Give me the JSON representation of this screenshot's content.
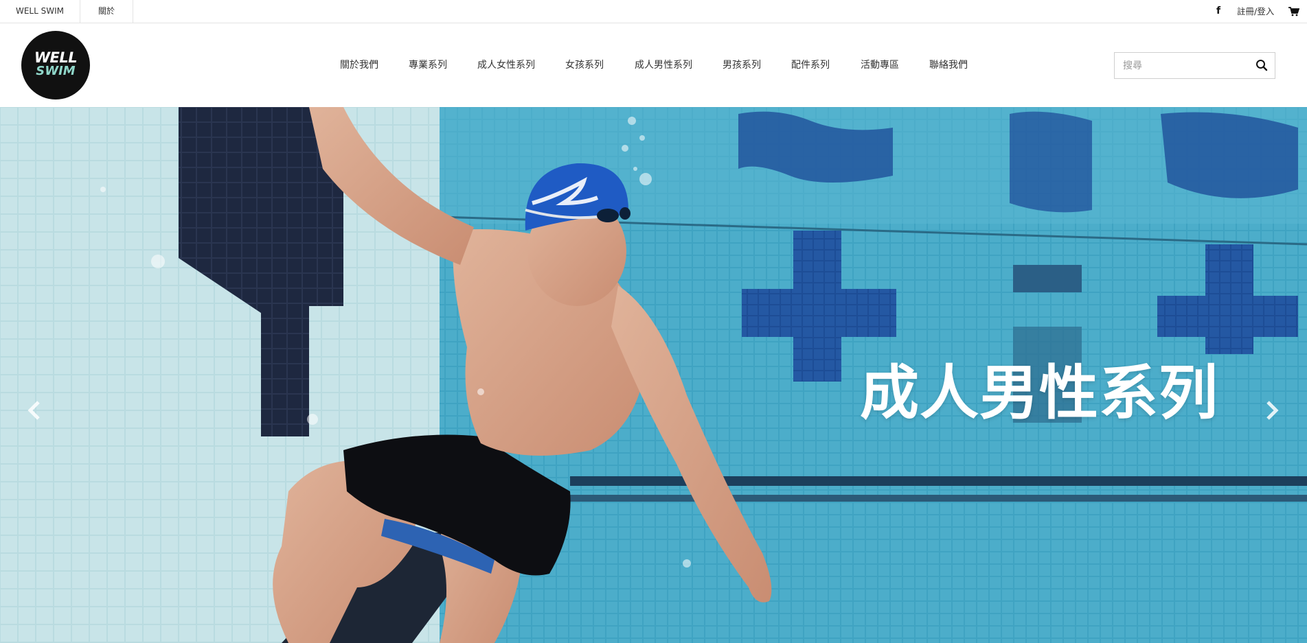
{
  "topbar": {
    "brand_label": "WELL SWIM",
    "about_label": "關於",
    "social_icon": "facebook-icon",
    "login_label": "註冊/登入",
    "cart_icon": "cart-icon"
  },
  "header": {
    "logo": {
      "line1": "WELL",
      "line2": "SWIM"
    },
    "nav": [
      {
        "label": "關於我們"
      },
      {
        "label": "專業系列"
      },
      {
        "label": "成人女性系列"
      },
      {
        "label": "女孩系列"
      },
      {
        "label": "成人男性系列"
      },
      {
        "label": "男孩系列"
      },
      {
        "label": "配件系列"
      },
      {
        "label": "活動專區"
      },
      {
        "label": "聯絡我們"
      }
    ],
    "search": {
      "placeholder": "搜尋",
      "value": "",
      "icon": "search-icon"
    }
  },
  "hero": {
    "caption": "成人男性系列",
    "prev_icon": "chevron-left-icon",
    "next_icon": "chevron-right-icon",
    "colors": {
      "water": "#4aa9c6",
      "tile_dark": "#1f2a44",
      "cap_blue": "#1f5bc4"
    }
  }
}
